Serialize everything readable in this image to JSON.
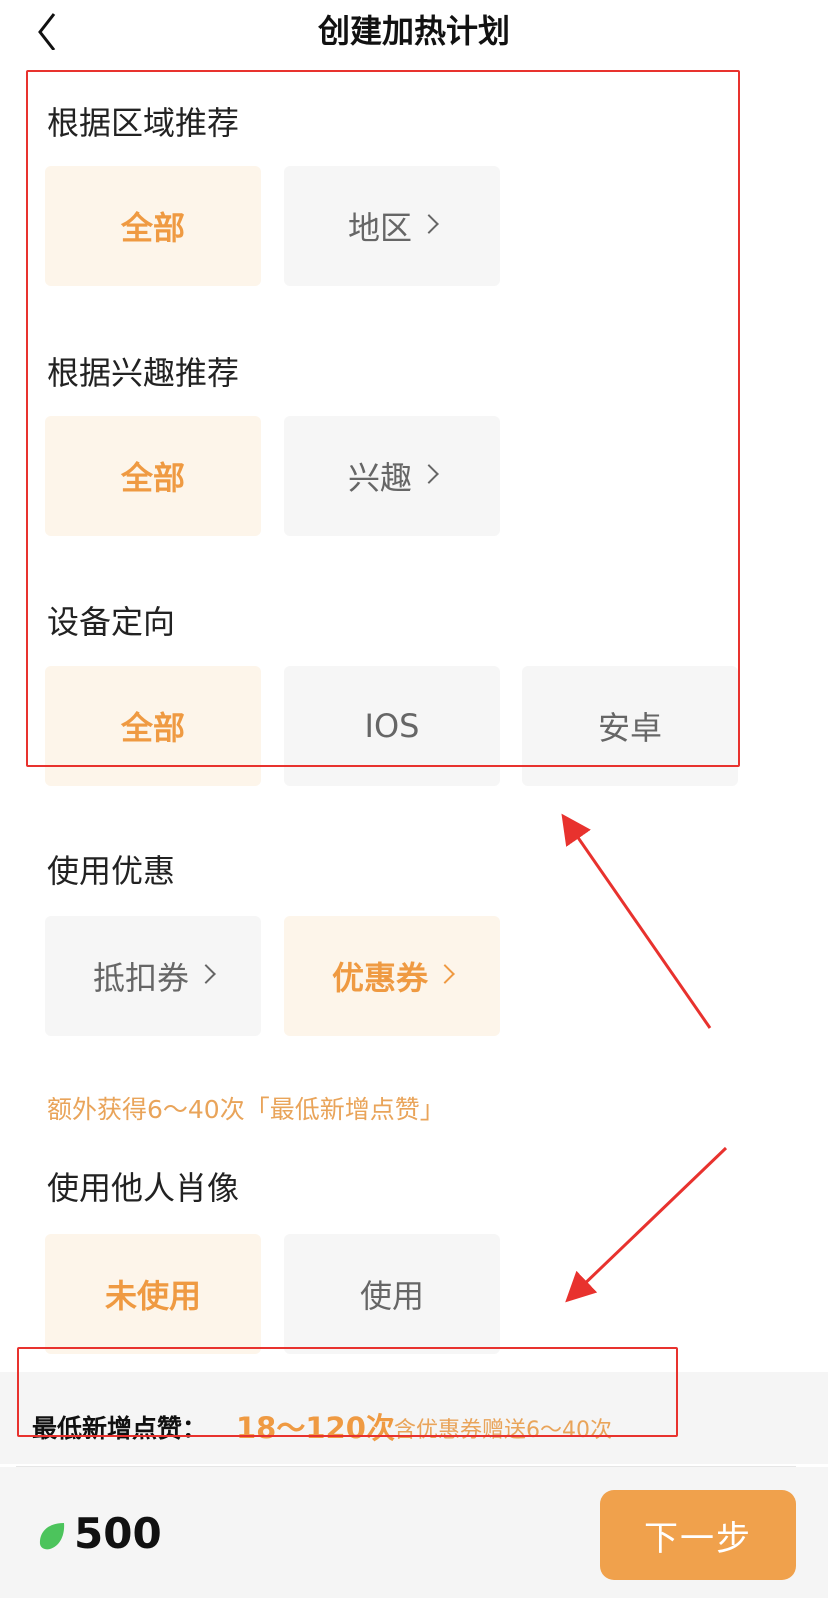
{
  "header": {
    "title": "创建加热计划"
  },
  "region": {
    "title": "根据区域推荐",
    "options": [
      "全部",
      "地区"
    ]
  },
  "interest": {
    "title": "根据兴趣推荐",
    "options": [
      "全部",
      "兴趣"
    ]
  },
  "device": {
    "title": "设备定向",
    "options": [
      "全部",
      "IOS",
      "安卓"
    ]
  },
  "discount": {
    "title": "使用优惠",
    "options": [
      "抵扣券",
      "优惠券"
    ],
    "tip": "额外获得6～40次「最低新增点赞」"
  },
  "portrait": {
    "title": "使用他人肖像",
    "options": [
      "未使用",
      "使用"
    ]
  },
  "summary": {
    "label": "最低新增点赞：",
    "range": "18～120次",
    "note": "含优惠券赠送6～40次"
  },
  "footer": {
    "balance": "500",
    "next_label": "下一步"
  },
  "colors": {
    "accent": "#ef9a42",
    "selected_bg": "#fdf5ea",
    "unselected_bg": "#f6f6f6",
    "annotation_red": "#e8322e",
    "leaf_green": "#4cc45c"
  },
  "icons": {
    "back": "chevron-left-icon",
    "chevron": "chevron-right-icon",
    "coin": "green-leaf-icon"
  }
}
